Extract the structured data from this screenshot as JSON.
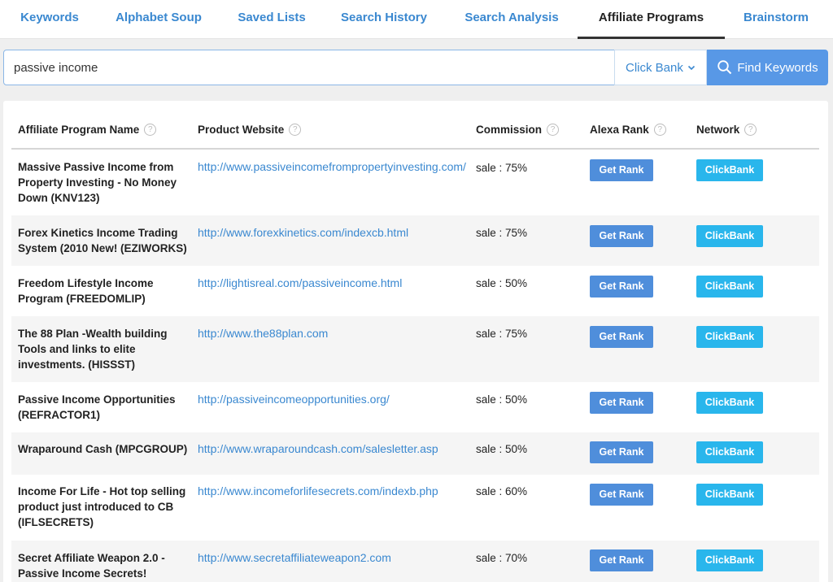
{
  "tabs": [
    {
      "label": "Keywords"
    },
    {
      "label": "Alphabet Soup"
    },
    {
      "label": "Saved Lists"
    },
    {
      "label": "Search History"
    },
    {
      "label": "Search Analysis"
    },
    {
      "label": "Affiliate Programs",
      "active": true
    },
    {
      "label": "Brainstorm"
    }
  ],
  "search": {
    "query": "passive income",
    "network": "Click Bank",
    "button_label": "Find Keywords"
  },
  "table": {
    "columns": [
      "Affiliate Program Name",
      "Product Website",
      "Commission",
      "Alexa Rank",
      "Network"
    ],
    "help_glyph": "?",
    "rows": [
      {
        "name": "Massive Passive Income from Property Investing - No Money Down (KNV123)",
        "url": "http://www.passiveincomefrompropertyinvesting.com/",
        "commission": "sale : 75%",
        "rank_button": "Get Rank",
        "network": "ClickBank"
      },
      {
        "name": "Forex Kinetics Income Trading System (2010 New! (EZIWORKS)",
        "url": "http://www.forexkinetics.com/indexcb.html",
        "commission": "sale : 75%",
        "rank_button": "Get Rank",
        "network": "ClickBank"
      },
      {
        "name": "Freedom Lifestyle Income Program (FREEDOMLIP)",
        "url": "http://lightisreal.com/passiveincome.html",
        "commission": "sale : 50%",
        "rank_button": "Get Rank",
        "network": "ClickBank"
      },
      {
        "name": "The 88 Plan -Wealth building Tools and links to elite investments. (HISSST)",
        "url": "http://www.the88plan.com",
        "commission": "sale : 75%",
        "rank_button": "Get Rank",
        "network": "ClickBank"
      },
      {
        "name": "Passive Income Opportunities (REFRACTOR1)",
        "url": "http://passiveincomeopportunities.org/",
        "commission": "sale : 50%",
        "rank_button": "Get Rank",
        "network": "ClickBank"
      },
      {
        "name": "Wraparound Cash (MPCGROUP)",
        "url": "http://www.wraparoundcash.com/salesletter.asp",
        "commission": "sale : 50%",
        "rank_button": "Get Rank",
        "network": "ClickBank"
      },
      {
        "name": "Income For Life - Hot top selling product just introduced to CB (IFLSECRETS)",
        "url": "http://www.incomeforlifesecrets.com/indexb.php",
        "commission": "sale : 60%",
        "rank_button": "Get Rank",
        "network": "ClickBank"
      },
      {
        "name": "Secret Affiliate Weapon 2.0 - Passive Income Secrets!",
        "url": "http://www.secretaffiliateweapon2.com",
        "commission": "sale : 70%",
        "rank_button": "Get Rank",
        "network": "ClickBank"
      }
    ]
  },
  "colors": {
    "accent": "#3a88d0",
    "find_button": "#5898e6",
    "get_rank_button": "#4f8edb",
    "network_badge": "#29b6ec"
  }
}
